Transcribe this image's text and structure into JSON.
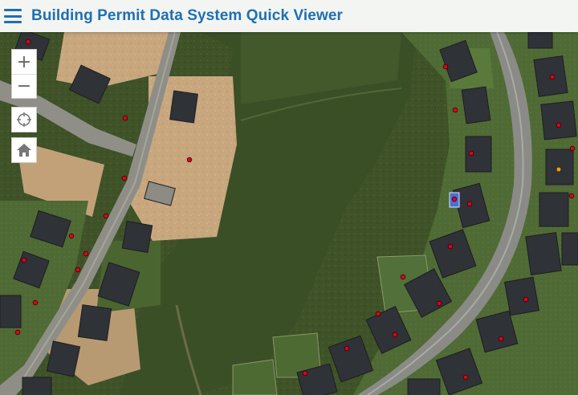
{
  "header": {
    "menu_icon": "hamburger-menu-icon",
    "title": "Building Permit Data System Quick Viewer",
    "title_color": "#1f6fb2"
  },
  "controls": {
    "zoom_in_label": "+",
    "zoom_out_label": "−",
    "zoom_in_icon": "plus-icon",
    "zoom_out_icon": "minus-icon",
    "locate_icon": "crosshair-icon",
    "home_icon": "home-icon"
  },
  "map": {
    "basemap": "aerial imagery",
    "permit_marker_color": "#e0001b",
    "highlight_marker_color": "#f0a020"
  }
}
